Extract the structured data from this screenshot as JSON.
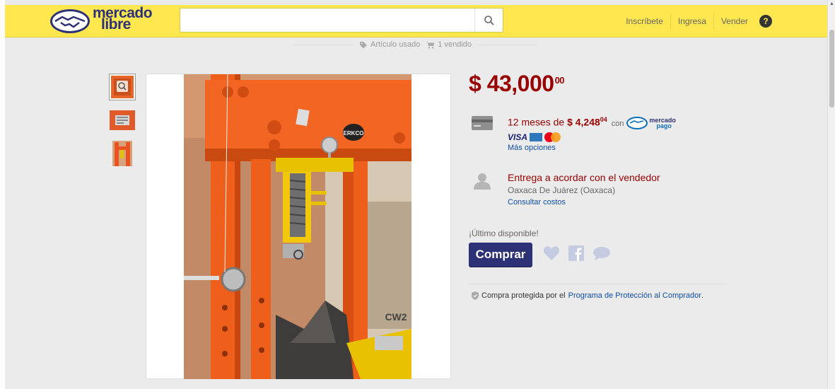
{
  "header": {
    "logo_line1": "mercado",
    "logo_line2": "libre",
    "search_placeholder": "",
    "nav": [
      "Inscríbete",
      "Ingresa",
      "Vender"
    ],
    "help_label": "?"
  },
  "meta": {
    "condition": "Artículo usado",
    "sold": "1 vendido"
  },
  "product": {
    "price": "$ 43,000",
    "price_cents": "00",
    "installments": {
      "text": "12 meses de",
      "amount": "$ 4,248",
      "amount_cents": "04",
      "con": "con",
      "mp_line1": "mercado",
      "mp_line2": "pago",
      "visa": "VISA",
      "more": "Más opciones"
    },
    "delivery": {
      "title": "Entrega a acordar con el vendedor",
      "location": "Oaxaca De Juárez (Oaxaca)",
      "link": "Consultar costos"
    },
    "stock": "¡Último disponible!",
    "buy": "Comprar",
    "protection_prefix": "Compra protegida por el",
    "protection_link": "Programa de Protección al Comprador",
    "protection_suffix": ".",
    "image_brand": "ERKCO",
    "image_text": "CW2"
  },
  "colors": {
    "header_bg": "#ffe74f",
    "brand_blue": "#2d3277",
    "price_red": "#990000",
    "link_blue": "#0f4ea6"
  }
}
